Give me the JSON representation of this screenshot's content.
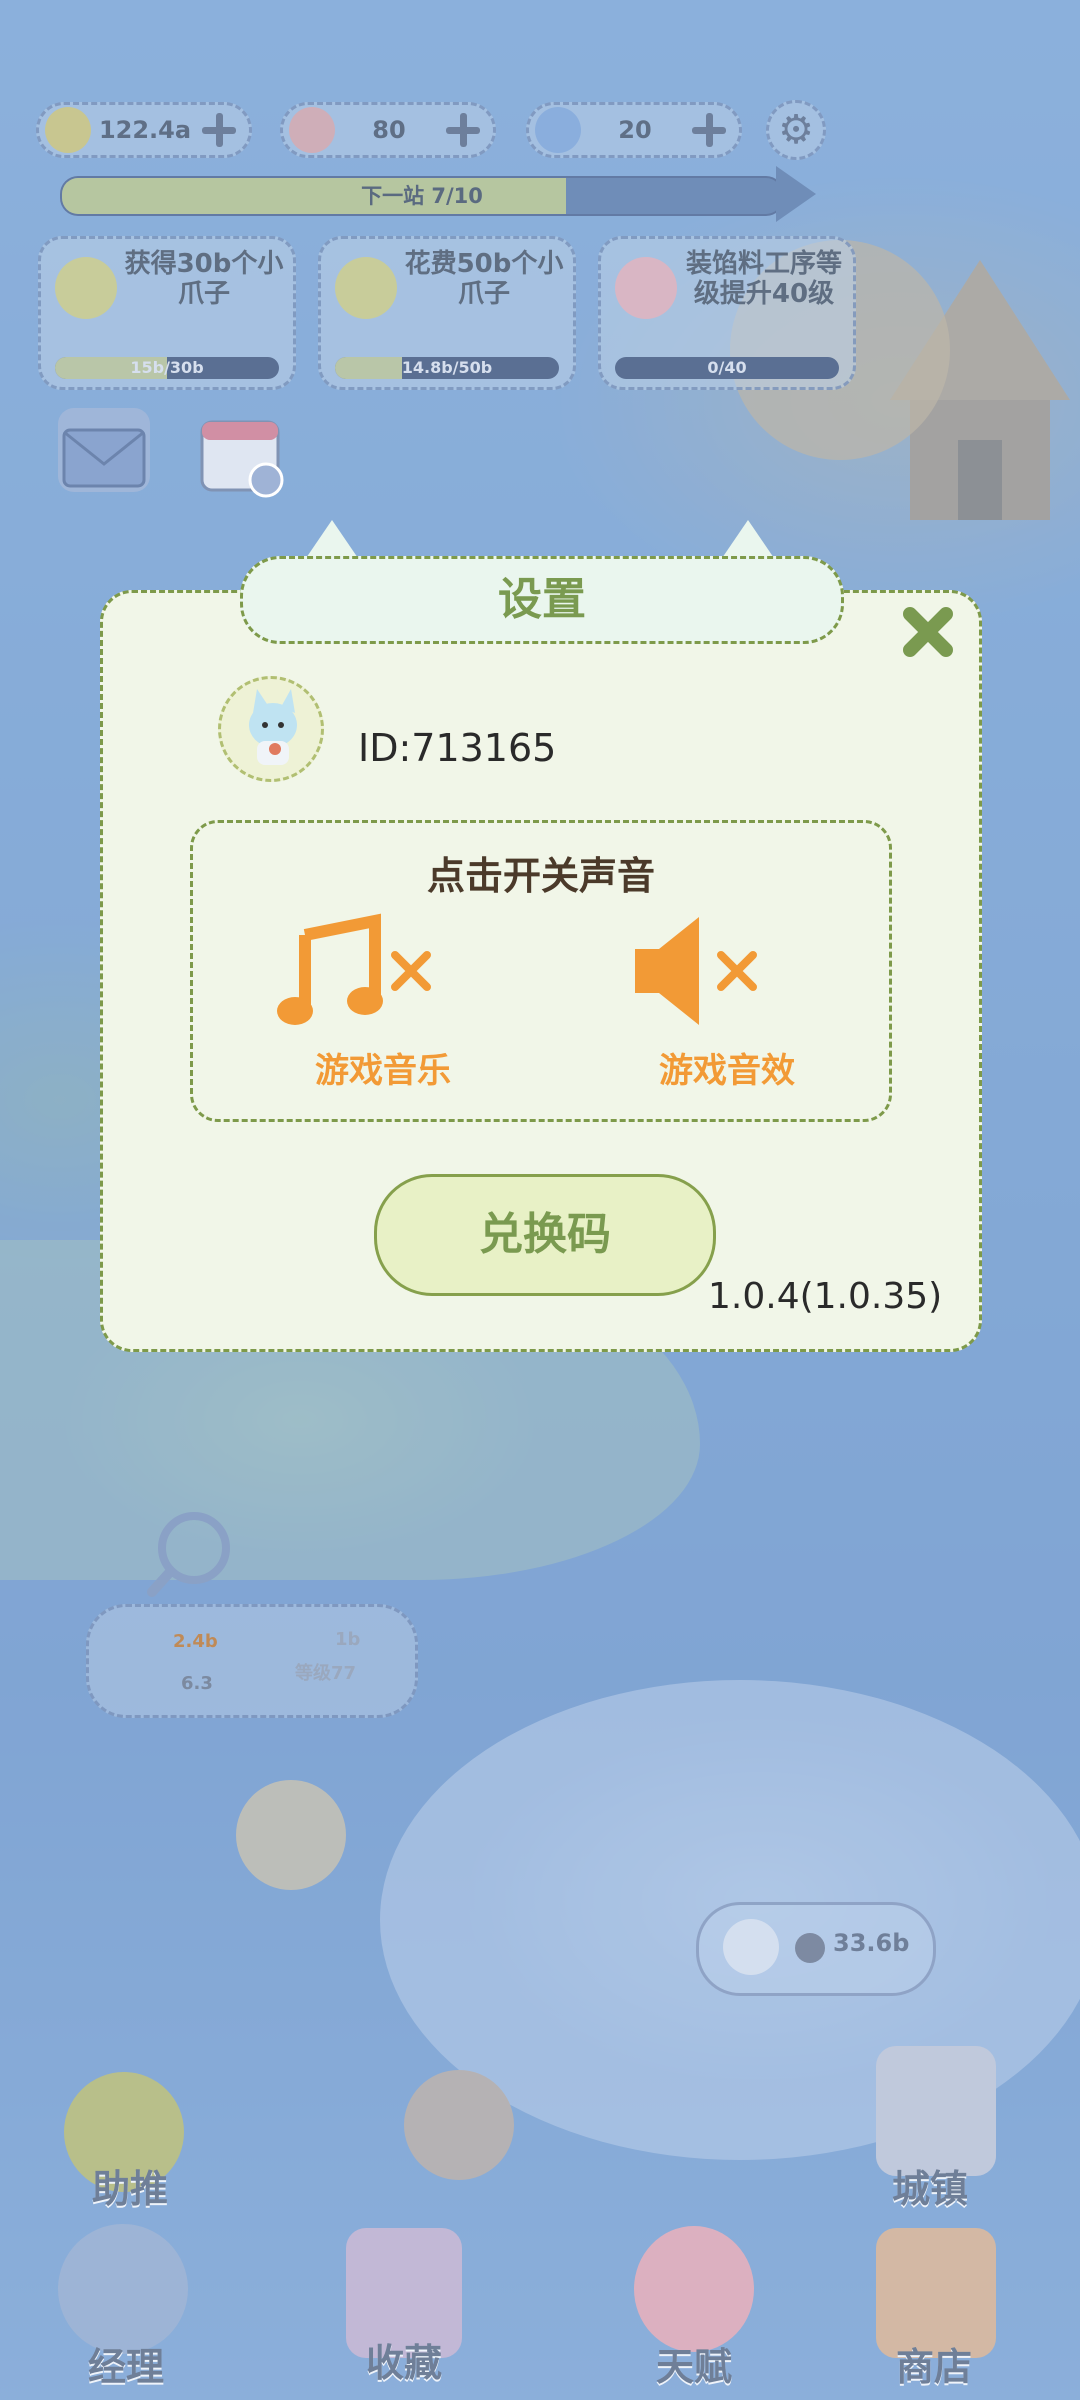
{
  "resources": [
    {
      "name": "paw-coins",
      "value": "122.4a"
    },
    {
      "name": "shells",
      "value": "80"
    },
    {
      "name": "gems",
      "value": "20"
    }
  ],
  "next_stop": {
    "label": "下一站 7/10",
    "progress": 0.7
  },
  "quests": [
    {
      "title": "获得30b个小爪子",
      "progress_text": "15b/30b",
      "progress": 0.5
    },
    {
      "title": "花费50b个小爪子",
      "progress_text": "14.8b/50b",
      "progress": 0.3
    },
    {
      "title": "装馅料工序等级提升40级",
      "progress_text": "0/40",
      "progress": 0.0
    }
  ],
  "settings": {
    "title": "设置",
    "user_id": "ID:713165",
    "sound_title": "点击开关声音",
    "music_label": "游戏音乐",
    "sfx_label": "游戏音效",
    "music_on": false,
    "sfx_on": false,
    "redeem_label": "兑换码",
    "version": "1.0.4(1.0.35)"
  },
  "station": {
    "income": "2.4b",
    "time": "6.3",
    "boost": "1b",
    "level": "等级77"
  },
  "coin_bubble": "33.6b",
  "nav": {
    "assist": "助推",
    "town": "城镇",
    "manager": "经理",
    "collection": "收藏",
    "talent": "天赋",
    "shop": "商店"
  },
  "colors": {
    "accent_green": "#7a9a50",
    "orange": "#f29a36",
    "dialog_bg": "#f1f6e8"
  }
}
